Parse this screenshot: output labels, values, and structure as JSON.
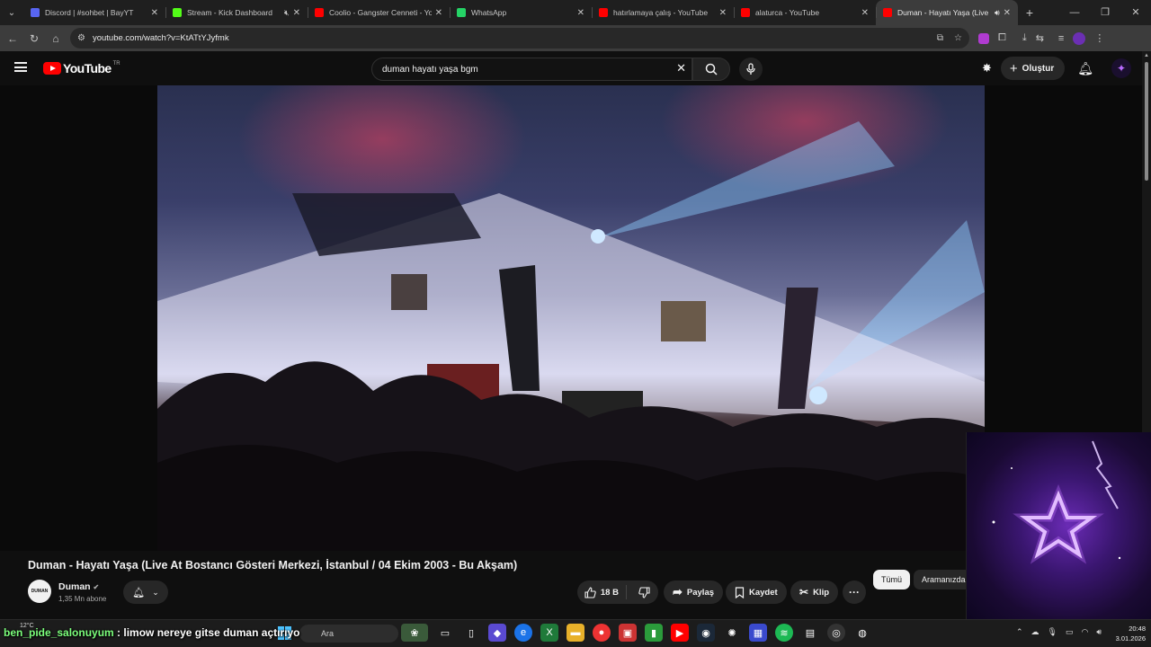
{
  "browser": {
    "tabs": [
      {
        "title": "Discord | #sohbet | BayYT",
        "color": "#5865f2",
        "active": false
      },
      {
        "title": "Stream - Kick Dashboard",
        "color": "#53fc18",
        "active": false,
        "muted": true
      },
      {
        "title": "Coolio - Gangster Cenneti - Yo",
        "color": "#ff0000",
        "active": false
      },
      {
        "title": "WhatsApp",
        "color": "#25d366",
        "active": false
      },
      {
        "title": "hatırlamaya çalış - YouTube",
        "color": "#ff0000",
        "active": false
      },
      {
        "title": "alaturca - YouTube",
        "color": "#ff0000",
        "active": false
      },
      {
        "title": "Duman - Hayatı Yaşa (Live",
        "color": "#ff0000",
        "active": true,
        "playing": true
      }
    ],
    "url": "youtube.com/watch?v=KtATtYJyfmk"
  },
  "youtube": {
    "logo_text": "YouTube",
    "country_code": "TR",
    "search_query": "duman hayatı yaşa bgm",
    "create_label": "Oluştur"
  },
  "video": {
    "title": "Duman - Hayatı Yaşa (Live At Bostancı Gösteri Merkezi, İstanbul / 04 Ekim 2003 - Bu Akşam)",
    "channel_name": "Duman",
    "channel_avatar_text": "DUMAN",
    "subscribers": "1,35 Mn abone",
    "likes": "18 B",
    "share_label": "Paylaş",
    "save_label": "Kaydet",
    "clip_label": "Klip"
  },
  "chips": {
    "all": "Tümü",
    "related": "Aramanızda"
  },
  "chat": {
    "user": "ben_pide_salonuyum",
    "message": "limow nereye gitse duman açtırıyo"
  },
  "taskbar": {
    "weather": "12°C",
    "search_placeholder": "Ara",
    "time": "20:48",
    "date": "3.01.2026"
  }
}
